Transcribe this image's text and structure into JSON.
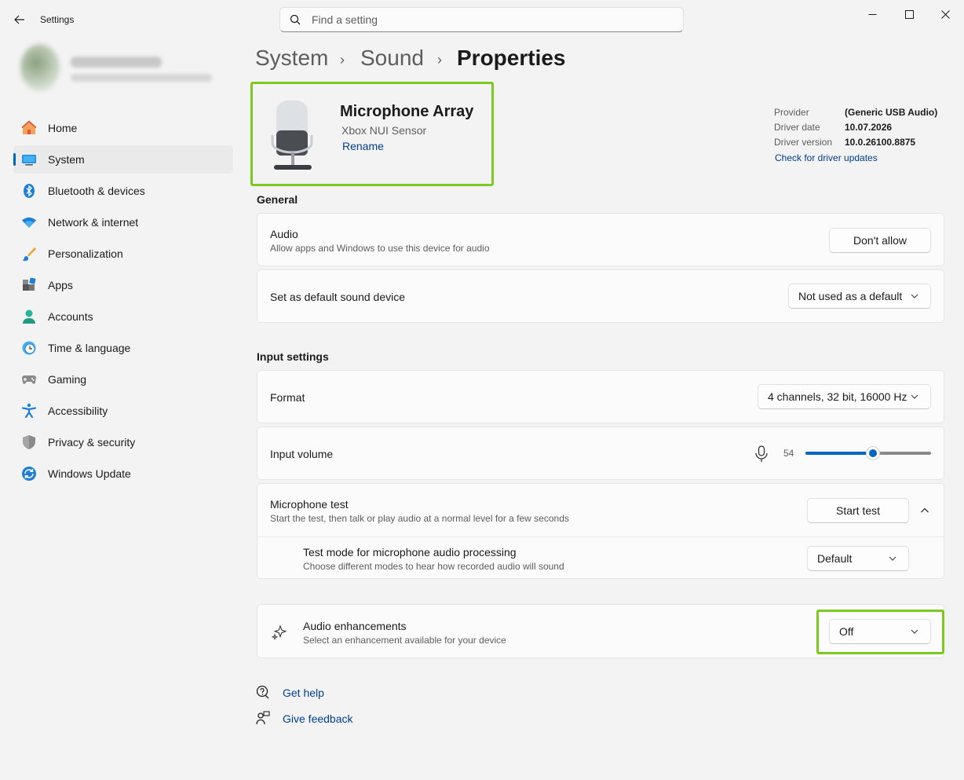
{
  "app": {
    "title": "Settings"
  },
  "search": {
    "placeholder": "Find a setting"
  },
  "sidebar": {
    "items": [
      {
        "label": "Home",
        "icon": "home-icon"
      },
      {
        "label": "System",
        "icon": "system-icon",
        "selected": true
      },
      {
        "label": "Bluetooth & devices",
        "icon": "bluetooth-icon"
      },
      {
        "label": "Network & internet",
        "icon": "wifi-icon"
      },
      {
        "label": "Personalization",
        "icon": "brush-icon"
      },
      {
        "label": "Apps",
        "icon": "apps-icon"
      },
      {
        "label": "Accounts",
        "icon": "person-icon"
      },
      {
        "label": "Time & language",
        "icon": "clock-globe-icon"
      },
      {
        "label": "Gaming",
        "icon": "gamepad-icon"
      },
      {
        "label": "Accessibility",
        "icon": "accessibility-icon"
      },
      {
        "label": "Privacy & security",
        "icon": "shield-icon"
      },
      {
        "label": "Windows Update",
        "icon": "update-icon"
      }
    ]
  },
  "breadcrumb": {
    "items": [
      "System",
      "Sound",
      "Properties"
    ],
    "separator": "›"
  },
  "device": {
    "name": "Microphone Array",
    "subtitle": "Xbox NUI Sensor",
    "rename_label": "Rename"
  },
  "driver": {
    "provider_label": "Provider",
    "provider_value": "(Generic USB Audio)",
    "date_label": "Driver date",
    "date_value": "10.07.2026",
    "version_label": "Driver version",
    "version_value": "10.0.26100.8875",
    "update_link": "Check for driver updates"
  },
  "general": {
    "heading": "General",
    "audio_title": "Audio",
    "audio_desc": "Allow apps and Windows to use this device for audio",
    "audio_button": "Don't allow",
    "default_title": "Set as default sound device",
    "default_value": "Not used as a default"
  },
  "input": {
    "heading": "Input settings",
    "format_title": "Format",
    "format_value": "4 channels, 32 bit, 16000 Hz",
    "volume_title": "Input volume",
    "volume_value": "54",
    "volume_level": 0.54,
    "mictest_title": "Microphone test",
    "mictest_desc": "Start the test, then talk or play audio at a normal level for a few seconds",
    "mictest_button": "Start test",
    "testmode_title": "Test mode for microphone audio processing",
    "testmode_desc": "Choose different modes to hear how recorded audio will sound",
    "testmode_value": "Default"
  },
  "enhancements": {
    "title": "Audio enhancements",
    "desc": "Select an enhancement available for your device",
    "value": "Off"
  },
  "help": {
    "get_help": "Get help",
    "give_feedback": "Give feedback"
  },
  "colors": {
    "accent": "#0067c0",
    "highlight": "#7cc91f",
    "link": "#003e92"
  }
}
